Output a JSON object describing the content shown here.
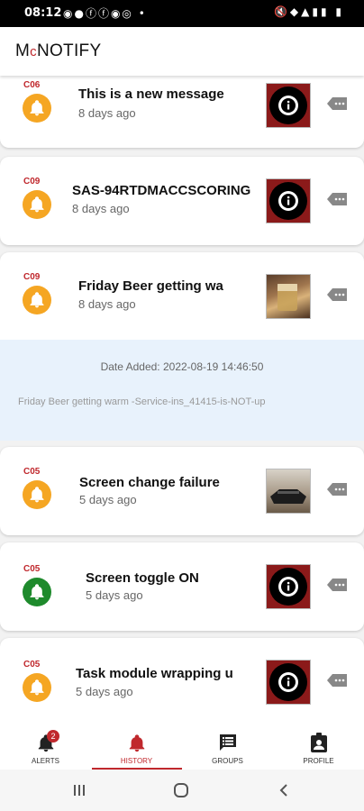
{
  "status_bar": {
    "time": "08:12",
    "notif_icons": [
      "whatsapp-icon",
      "messenger-icon",
      "facebook-icon",
      "facebook-icon",
      "messenger-icon",
      "instagram-icon",
      "dot-icon"
    ],
    "sys_icons": [
      "mute-icon",
      "location-icon",
      "wifi-icon",
      "signal-icon",
      "battery-icon"
    ]
  },
  "app": {
    "brand_prefix": "M",
    "brand_small": "c",
    "brand_rest": "NOTIFY"
  },
  "colors": {
    "accent": "#c0282d",
    "bell_orange": "#f5a623",
    "bell_green": "#1e8a2c",
    "detail_bg": "#e8f2fc"
  },
  "alerts": [
    {
      "code": "C06",
      "title": "This is a new message",
      "ago": "8 days ago",
      "bell": "orange",
      "thumb": "info"
    },
    {
      "code": "C09",
      "title": "SAS-94RTDMACCSCORING",
      "ago": "8 days ago",
      "bell": "orange",
      "thumb": "info"
    },
    {
      "code": "C09",
      "title": "Friday Beer getting wa",
      "ago": "8 days ago",
      "bell": "orange",
      "thumb": "photo-beer"
    },
    {
      "code": "C05",
      "title": "Screen change failure",
      "ago": "5 days ago",
      "bell": "orange",
      "thumb": "photo-screen"
    },
    {
      "code": "C05",
      "title": "Screen toggle ON",
      "ago": "5 days ago",
      "bell": "green",
      "thumb": "info"
    },
    {
      "code": "C05",
      "title": "Task module wrapping u",
      "ago": "5 days ago",
      "bell": "orange",
      "thumb": "info"
    }
  ],
  "detail": {
    "date_added": "Date Added: 2022-08-19 14:46:50",
    "message": "Friday Beer getting warm -Service-ins_41415-is-NOT-up"
  },
  "nav": {
    "tabs": [
      {
        "label": "ALERTS",
        "icon": "bell-icon",
        "badge": "2"
      },
      {
        "label": "HISTORY",
        "icon": "bell-icon",
        "active": true
      },
      {
        "label": "GROUPS",
        "icon": "groups-icon"
      },
      {
        "label": "PROFILE",
        "icon": "profile-icon"
      }
    ]
  },
  "system_nav": [
    "recents-icon",
    "home-icon",
    "back-icon"
  ]
}
